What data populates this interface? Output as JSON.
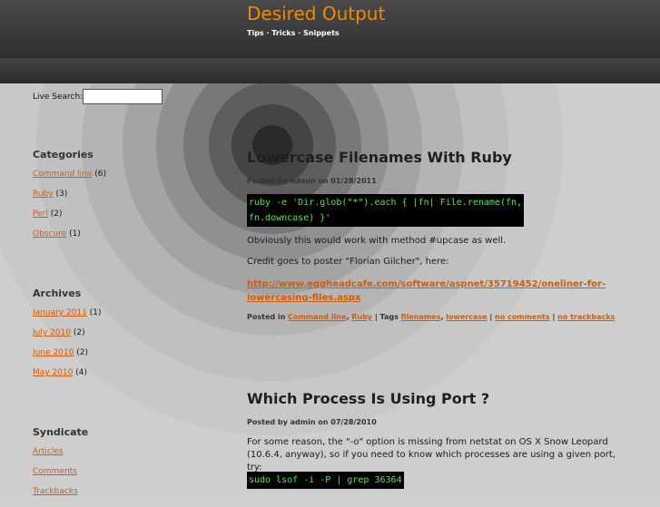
{
  "header": {
    "site_title": "Desired Output",
    "tagline": "Tips · Tricks · Snippets"
  },
  "sidebar": {
    "search_label": "Live Search:",
    "search_value": "",
    "categories": {
      "heading": "Categories",
      "items": [
        {
          "label": "Command line",
          "count": "(6)"
        },
        {
          "label": "Ruby",
          "count": "(3)"
        },
        {
          "label": "Perl",
          "count": "(2)"
        },
        {
          "label": "Obscure",
          "count": "(1)"
        }
      ]
    },
    "archives": {
      "heading": "Archives",
      "items": [
        {
          "label": "January 2011",
          "count": "(1)"
        },
        {
          "label": "July 2010",
          "count": "(2)"
        },
        {
          "label": "June 2010",
          "count": "(2)"
        },
        {
          "label": "May 2010",
          "count": "(4)"
        }
      ]
    },
    "syndicate": {
      "heading": "Syndicate",
      "items": [
        {
          "label": "Articles"
        },
        {
          "label": "Comments"
        },
        {
          "label": "Trackbacks"
        }
      ]
    }
  },
  "posts": [
    {
      "title": "Lowercase Filenames With Ruby",
      "meta": "Posted by admin on 01/28/2011",
      "code_line1": "ruby -e 'Dir.glob(\"*\").each { |fn| File.rename(fn,",
      "code_line2": "fn.downcase) }'",
      "para1": "Obviously this would work with method #upcase as well.",
      "para2": "Credit goes to poster \"Florian Gilcher\", here:",
      "link_line1": "http://www.eggheadcafe.com/software/aspnet/35719452/oneliner-for-",
      "link_line2": "lowercasing-files.aspx",
      "footer": {
        "posted_in": "Posted in",
        "cat1": "Command line",
        "sep": ",",
        "cat2": "Ruby",
        "tags_label": "| Tags",
        "tag1": "filenames",
        "tag2": "lowercase",
        "pipe": "|",
        "comments": "no comments",
        "trackbacks": "no trackbacks"
      }
    },
    {
      "title": "Which Process Is Using Port ?",
      "meta": "Posted by admin on 07/28/2010",
      "para1": "For some reason, the \"-o\" option is missing from netstat on OS X Snow Leopard",
      "para1b": "(10.6.4, anyway), so if you need to know which processes are using a given port, try:",
      "code_line1": "sudo lsof -i -P | grep 36364"
    }
  ]
}
